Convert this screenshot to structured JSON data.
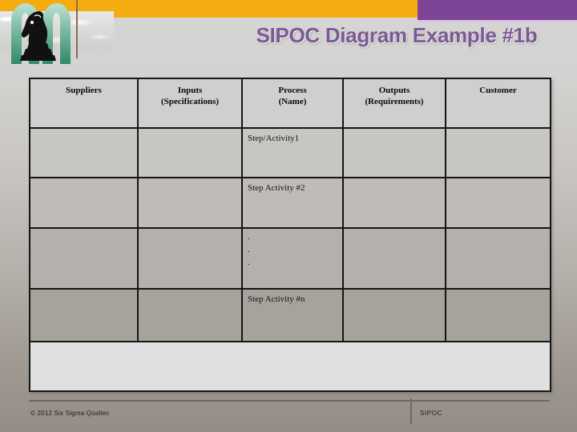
{
  "slide": {
    "title": "SIPOC Diagram Example #1b",
    "accent_orange": "#f5ac10",
    "accent_purple": "#7e4496",
    "title_color": "#7b5a93"
  },
  "logo": {
    "name": "six-sigma-qualtec-knight-logo",
    "mark_color": "#4f9e84",
    "knight_color": "#111111"
  },
  "table": {
    "headers": [
      "Suppliers",
      "Inputs\n(Specifications)",
      "Process\n(Name)",
      "Outputs\n(Requirements)",
      "Customer"
    ],
    "headers_split": [
      {
        "line1": "Suppliers",
        "line2": ""
      },
      {
        "line1": "Inputs",
        "line2": "(Specifications)"
      },
      {
        "line1": "Process",
        "line2": "(Name)"
      },
      {
        "line1": "Outputs",
        "line2": "(Requirements)"
      },
      {
        "line1": "Customer",
        "line2": ""
      }
    ],
    "rows": [
      {
        "suppliers": "",
        "inputs": "",
        "process": "Step/Activity1",
        "outputs": "",
        "customer": ""
      },
      {
        "suppliers": "",
        "inputs": "",
        "process": "Step Activity #2",
        "outputs": "",
        "customer": ""
      },
      {
        "suppliers": "",
        "inputs": "",
        "process": ".\n.\n.",
        "outputs": "",
        "customer": ""
      },
      {
        "suppliers": "",
        "inputs": "",
        "process": "Step Activity #n",
        "outputs": "",
        "customer": ""
      }
    ],
    "ellipsis_dots": [
      ".",
      ".",
      "."
    ],
    "footer_row": ""
  },
  "footer": {
    "copyright": "© 2012 Six Sigma Qualtec",
    "label": "SIPOC"
  }
}
